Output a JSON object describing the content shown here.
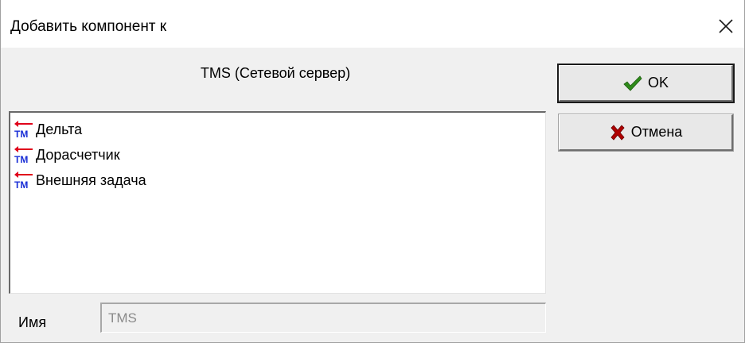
{
  "window": {
    "title": "Добавить компонент к",
    "close_icon": "close-icon"
  },
  "server_label": "TMS (Сетевой сервер)",
  "components": [
    {
      "label": "Дельта",
      "icon": "tm-component-icon"
    },
    {
      "label": "Дорасчетчик",
      "icon": "tm-component-icon"
    },
    {
      "label": "Внешняя задача",
      "icon": "tm-component-icon"
    }
  ],
  "buttons": {
    "ok_label": "OK",
    "ok_icon": "checkmark-icon",
    "cancel_label": "Отмена",
    "cancel_icon": "cross-icon"
  },
  "name_field": {
    "label": "Имя",
    "value": "TMS"
  },
  "colors": {
    "tm_arrow": "#e0001a",
    "tm_text": "#1a2fd6",
    "check": "#2e8b1a",
    "cross": "#b00000"
  }
}
